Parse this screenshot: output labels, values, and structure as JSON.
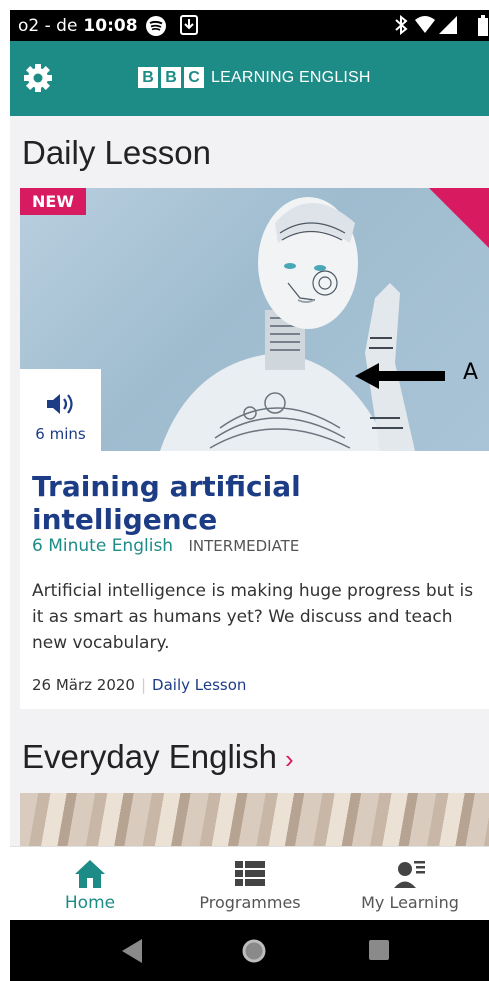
{
  "status_bar": {
    "carrier": "o2 - de",
    "time": "10:08"
  },
  "app_bar": {
    "settings_icon": "gear-icon",
    "brand_letters": [
      "B",
      "B",
      "C"
    ],
    "brand_text": "LEARNING ENGLISH"
  },
  "daily_lesson": {
    "section_title": "Daily Lesson",
    "badge": "NEW",
    "audio_icon": "speaker-icon",
    "duration": "6 mins",
    "title": "Training artificial intelligence",
    "series": "6 Minute English",
    "level": "INTERMEDIATE",
    "description": "Artificial intelligence is making huge progress but is it as smart as humans yet? We discuss and teach new vocabulary.",
    "date": "26 März 2020",
    "category": "Daily Lesson"
  },
  "annotation": {
    "arrow_icon": "arrow-left-icon",
    "text": "A"
  },
  "everyday_english": {
    "section_title": "Everyday English",
    "chevron": "›"
  },
  "bottom_nav": {
    "items": [
      {
        "label": "Home",
        "icon": "home-icon",
        "active": true
      },
      {
        "label": "Programmes",
        "icon": "list-icon",
        "active": false
      },
      {
        "label": "My Learning",
        "icon": "learner-icon",
        "active": false
      }
    ]
  },
  "colors": {
    "brand_teal": "#1d8c87",
    "accent_pink": "#d81b60",
    "title_blue": "#1c3d86"
  }
}
